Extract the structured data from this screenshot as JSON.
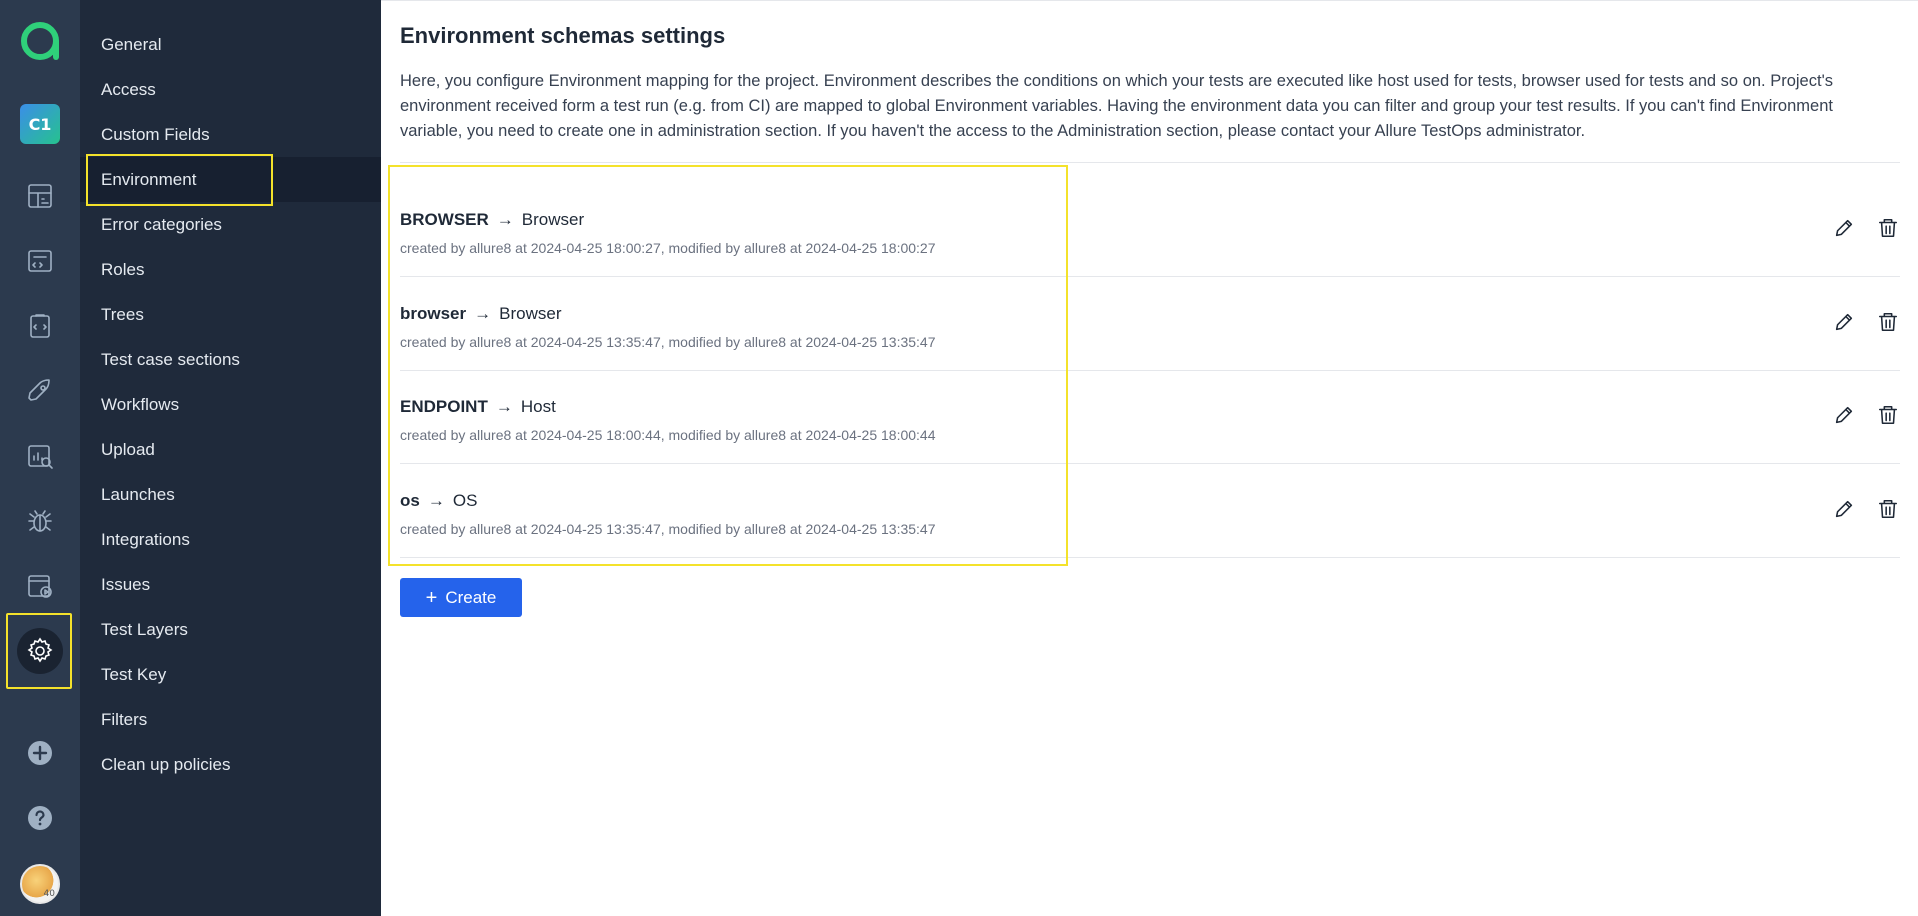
{
  "app": {
    "brand_color": "#2563eb",
    "highlight_color": "#f4e22b"
  },
  "rail": {
    "project_badge": "C1",
    "avatar_badge": "40",
    "icons": [
      "allure-logo-icon",
      "dashboard-icon",
      "test-cases-icon",
      "test-plans-icon",
      "launches-icon",
      "analytics-icon",
      "defects-icon",
      "jobs-icon",
      "settings-icon",
      "add-icon",
      "help-icon",
      "avatar"
    ]
  },
  "menu": {
    "items": [
      {
        "label": "General"
      },
      {
        "label": "Access"
      },
      {
        "label": "Custom Fields"
      },
      {
        "label": "Environment"
      },
      {
        "label": "Error categories"
      },
      {
        "label": "Roles"
      },
      {
        "label": "Trees"
      },
      {
        "label": "Test case sections"
      },
      {
        "label": "Workflows"
      },
      {
        "label": "Upload"
      },
      {
        "label": "Launches"
      },
      {
        "label": "Integrations"
      },
      {
        "label": "Issues"
      },
      {
        "label": "Test Layers"
      },
      {
        "label": "Test Key"
      },
      {
        "label": "Filters"
      },
      {
        "label": "Clean up policies"
      }
    ],
    "active": "Environment"
  },
  "main": {
    "title": "Environment schemas settings",
    "description": "Here, you configure Environment mapping for the project. Environment describes the conditions on which your tests are executed like host used for tests, browser used for tests and so on. Project's environment received form a test run (e.g. from CI) are mapped to global Environment variables. Having the environment data you can filter and group your test results. If you can't find Environment variable, you need to create one in administration section. If you haven't the access to the Administration section, please contact your Allure TestOps administrator.",
    "rows": [
      {
        "key": "BROWSER",
        "arrow": "→",
        "target": "Browser",
        "meta": "created by allure8 at 2024-04-25 18:00:27, modified by allure8 at 2024-04-25 18:00:27"
      },
      {
        "key": "browser",
        "arrow": "→",
        "target": "Browser",
        "meta": "created by allure8 at 2024-04-25 13:35:47, modified by allure8 at 2024-04-25 13:35:47"
      },
      {
        "key": "ENDPOINT",
        "arrow": "→",
        "target": "Host",
        "meta": "created by allure8 at 2024-04-25 18:00:44, modified by allure8 at 2024-04-25 18:00:44"
      },
      {
        "key": "os",
        "arrow": "→",
        "target": "OS",
        "meta": "created by allure8 at 2024-04-25 13:35:47, modified by allure8 at 2024-04-25 13:35:47"
      }
    ],
    "create_label": "Create",
    "create_icon": "+"
  }
}
